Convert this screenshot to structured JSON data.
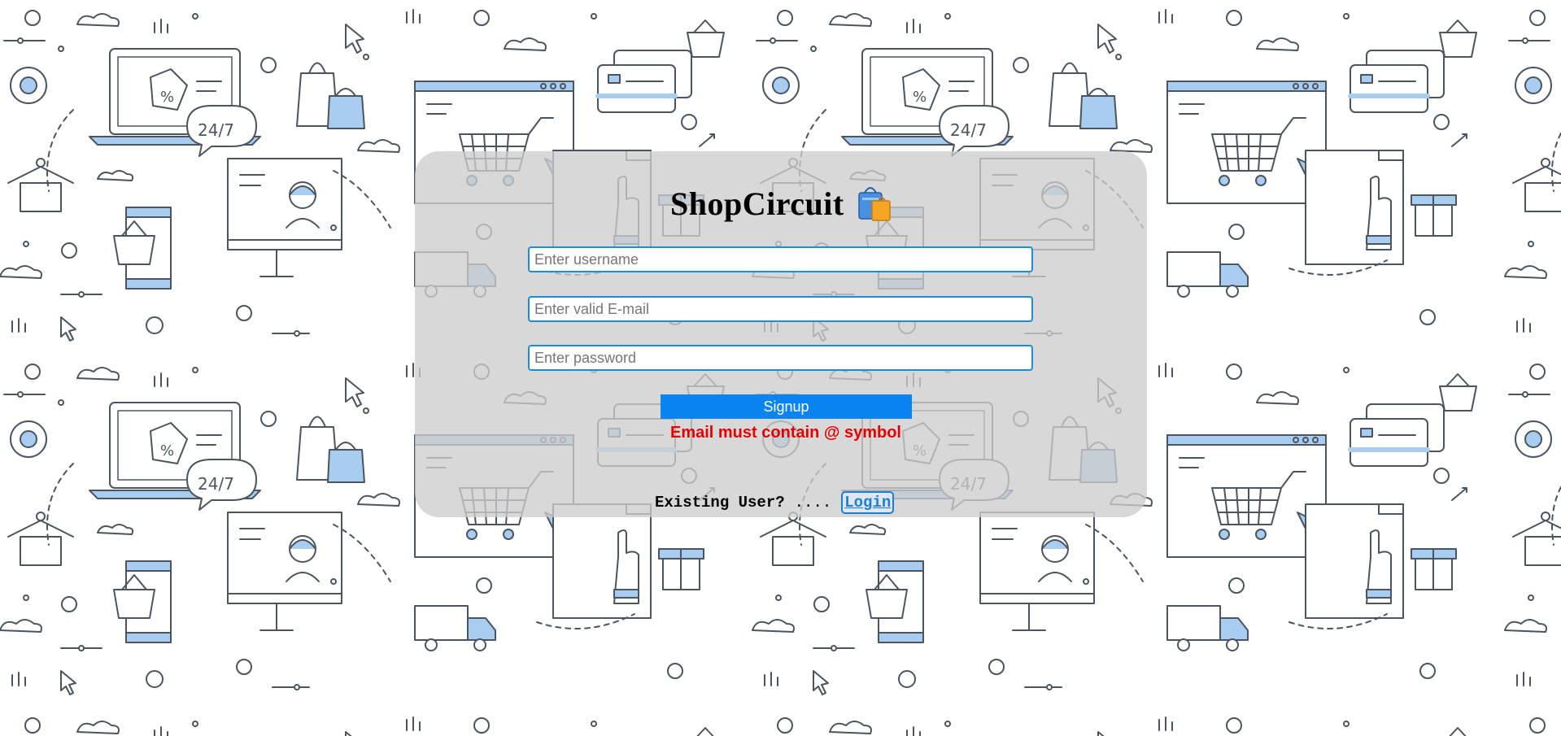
{
  "brand": {
    "title": "ShopCircuit",
    "logo_icon": "shopping-bag-icon"
  },
  "form": {
    "username_placeholder": "Enter username",
    "email_placeholder": "Enter valid E-mail",
    "password_placeholder": "Enter password",
    "signup_label": "Signup",
    "error_message": "Email must contain @ symbol"
  },
  "footer": {
    "existing_user_text": "Existing User?",
    "dots": "....",
    "login_label": "Login"
  },
  "colors": {
    "accent": "#0a84f0",
    "field_border": "#1a8fd6",
    "error": "#e60000",
    "card": "#cdcdcd",
    "illustration_blue": "#a8cdf0",
    "illustration_line": "#4a5560"
  }
}
